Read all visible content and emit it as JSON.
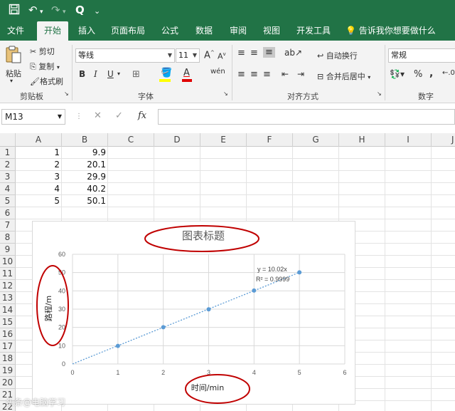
{
  "qat": {
    "undo": "↶",
    "redo": "↷",
    "preview": "Q",
    "customize": "⌄"
  },
  "tabs": [
    "文件",
    "开始",
    "插入",
    "页面布局",
    "公式",
    "数据",
    "审阅",
    "视图",
    "开发工具"
  ],
  "tell_me": "告诉我你想要做什么",
  "ribbon": {
    "clipboard": {
      "paste": "粘贴",
      "cut": "剪切",
      "copy": "复制",
      "format_painter": "格式刷",
      "group": "剪贴板"
    },
    "font": {
      "name": "等线",
      "size": "11",
      "bold": "B",
      "italic": "I",
      "underline": "U",
      "grow": "A",
      "shrink": "A",
      "group": "字体"
    },
    "alignment": {
      "wrap": "自动换行",
      "merge": "合并后居中",
      "group": "对齐方式"
    },
    "number": {
      "format": "常规",
      "percent": "%",
      "comma": ",",
      "group": "数字"
    }
  },
  "formula_bar": {
    "name_box": "M13",
    "value": ""
  },
  "columns": [
    "A",
    "B",
    "C",
    "D",
    "E",
    "F",
    "G",
    "H",
    "I",
    "J"
  ],
  "rows": [
    "1",
    "2",
    "3",
    "4",
    "5",
    "6",
    "7",
    "8",
    "9",
    "10",
    "11",
    "12",
    "13",
    "14",
    "15",
    "16",
    "17",
    "18",
    "19",
    "20",
    "21",
    "22"
  ],
  "cells": {
    "A": [
      "1",
      "2",
      "3",
      "4",
      "5"
    ],
    "B": [
      "9.9",
      "20.1",
      "29.9",
      "40.2",
      "50.1"
    ]
  },
  "watermark": "头条@电脑学习",
  "chart_data": {
    "type": "scatter",
    "title": "图表标题",
    "xlabel": "时间/min",
    "ylabel": "路程/m",
    "xlim": [
      0,
      6
    ],
    "ylim": [
      0,
      60
    ],
    "x_ticks": [
      "0",
      "1",
      "2",
      "3",
      "4",
      "5",
      "6"
    ],
    "y_ticks": [
      "0",
      "10",
      "20",
      "30",
      "40",
      "50",
      "60"
    ],
    "series": [
      {
        "x": [
          1,
          2,
          3,
          4,
          5
        ],
        "y": [
          9.9,
          20.1,
          29.9,
          40.2,
          50.1
        ]
      }
    ],
    "trendline": {
      "type": "linear",
      "slope": 10.02,
      "equation": "y = 10.02x",
      "r_squared": "R² = 0.9999"
    },
    "grid": true,
    "colors": {
      "points": "#5b9bd5",
      "annotation": "#c00000"
    }
  }
}
